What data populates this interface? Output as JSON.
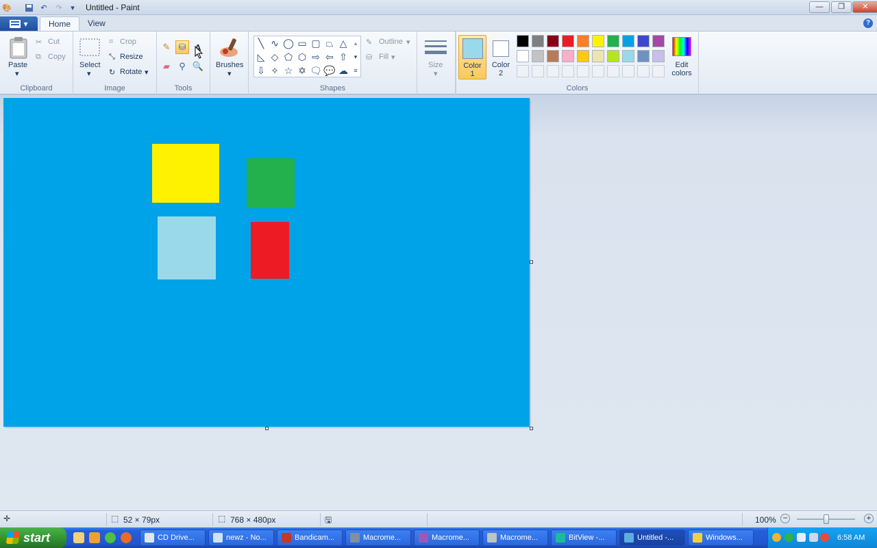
{
  "window": {
    "title": "Untitled - Paint"
  },
  "titlebar": {
    "minimize": "—",
    "restore": "❐",
    "close": "✕"
  },
  "tabs": [
    {
      "label": "Home"
    },
    {
      "label": "View"
    }
  ],
  "help": "?",
  "ribbon": {
    "clipboard": {
      "group_label": "Clipboard",
      "paste": "Paste",
      "cut": "Cut",
      "copy": "Copy"
    },
    "image": {
      "group_label": "Image",
      "select": "Select",
      "crop": "Crop",
      "resize": "Resize",
      "rotate": "Rotate"
    },
    "tools": {
      "group_label": "Tools"
    },
    "brushes": {
      "label": "Brushes"
    },
    "shapes": {
      "group_label": "Shapes",
      "outline": "Outline",
      "fill": "Fill"
    },
    "size": {
      "label": "Size"
    },
    "color1": {
      "label": "Color",
      "num": "1",
      "value": "#99d9ea"
    },
    "color2": {
      "label": "Color",
      "num": "2",
      "value": "#ffffff"
    },
    "colors": {
      "group_label": "Colors",
      "edit_label_1": "Edit",
      "edit_label_2": "colors",
      "palette_row1": [
        "#000000",
        "#7f7f7f",
        "#880015",
        "#ed1c24",
        "#ff7f27",
        "#fff200",
        "#22b14c",
        "#00a2e8",
        "#3f48cc",
        "#a349a4"
      ],
      "palette_row2": [
        "#ffffff",
        "#c3c3c3",
        "#b97a57",
        "#ffaec9",
        "#ffc90e",
        "#efe4b0",
        "#b5e61d",
        "#99d9ea",
        "#7092be",
        "#c8bfe7"
      ]
    }
  },
  "canvas": {
    "background": "#00a2e8",
    "shapes": [
      {
        "name": "yellow-rectangle",
        "color": "#fff200"
      },
      {
        "name": "green-rectangle",
        "color": "#22b14c"
      },
      {
        "name": "light-blue-rectangle",
        "color": "#99d9ea"
      },
      {
        "name": "red-rectangle",
        "color": "#ed1c24"
      }
    ]
  },
  "status": {
    "selection_size": "52 × 79px",
    "image_size": "768 × 480px",
    "zoom": "100%"
  },
  "taskbar": {
    "start": "start",
    "buttons": [
      {
        "label": "CD Drive..."
      },
      {
        "label": "newz - No..."
      },
      {
        "label": "Bandicam..."
      },
      {
        "label": "Macrome..."
      },
      {
        "label": "Macrome..."
      },
      {
        "label": "Macrome..."
      },
      {
        "label": "BitView -..."
      },
      {
        "label": "Untitled -..."
      },
      {
        "label": "Windows..."
      }
    ],
    "clock": "6:58 AM"
  }
}
